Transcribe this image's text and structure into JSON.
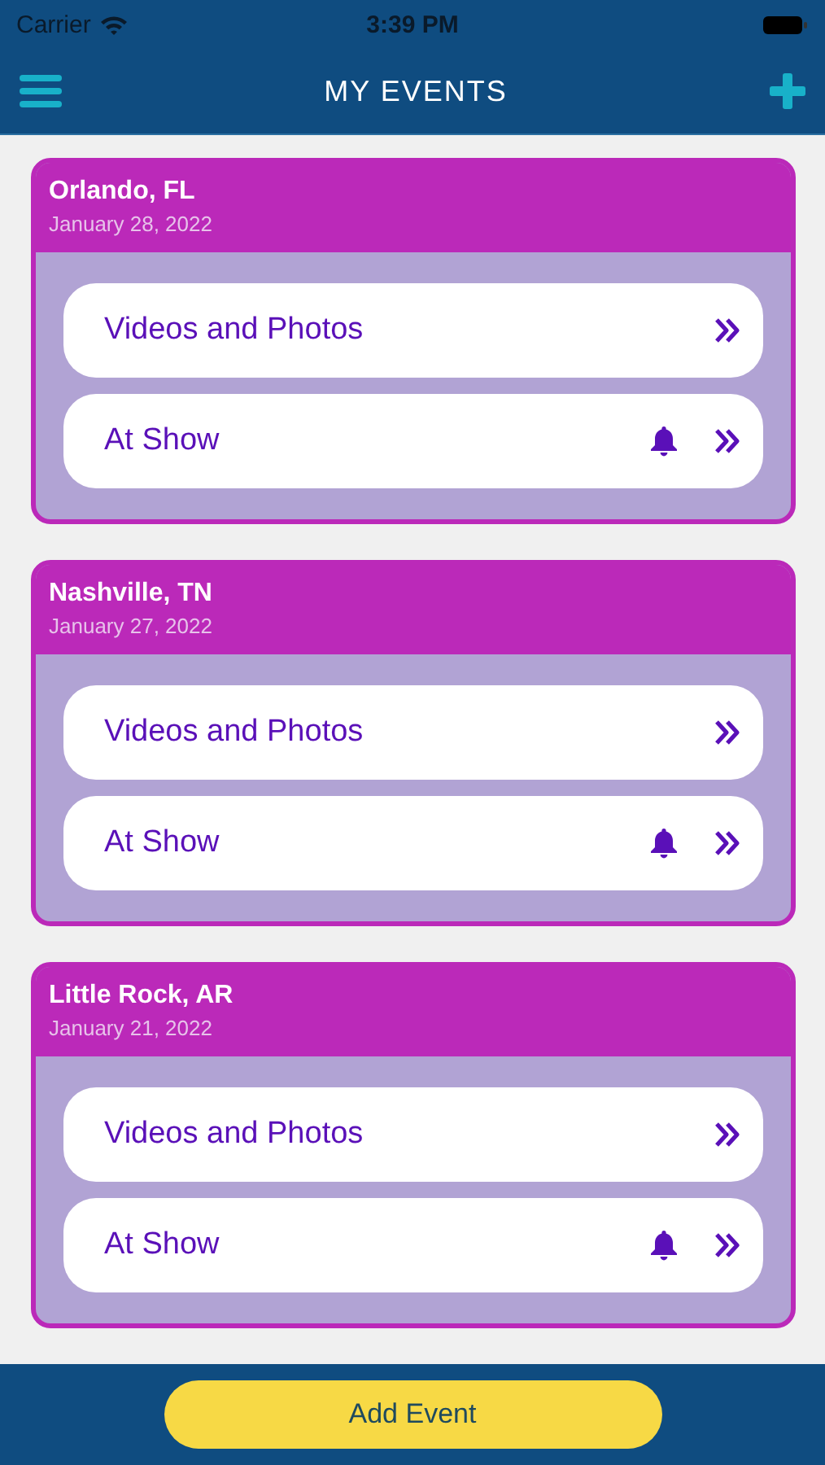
{
  "status_bar": {
    "carrier": "Carrier",
    "time": "3:39 PM"
  },
  "nav": {
    "title": "MY EVENTS"
  },
  "events": [
    {
      "city": "Orlando, FL",
      "date": "January 28, 2022",
      "rows": [
        {
          "label": "Videos and Photos",
          "bell": false
        },
        {
          "label": "At Show",
          "bell": true
        }
      ]
    },
    {
      "city": "Nashville, TN",
      "date": "January 27, 2022",
      "rows": [
        {
          "label": "Videos and Photos",
          "bell": false
        },
        {
          "label": "At Show",
          "bell": true
        }
      ]
    },
    {
      "city": "Little Rock, AR",
      "date": "January 21, 2022",
      "rows": [
        {
          "label": "Videos and Photos",
          "bell": false
        },
        {
          "label": "At Show",
          "bell": true
        }
      ]
    }
  ],
  "bottom": {
    "button": "Add Event"
  }
}
